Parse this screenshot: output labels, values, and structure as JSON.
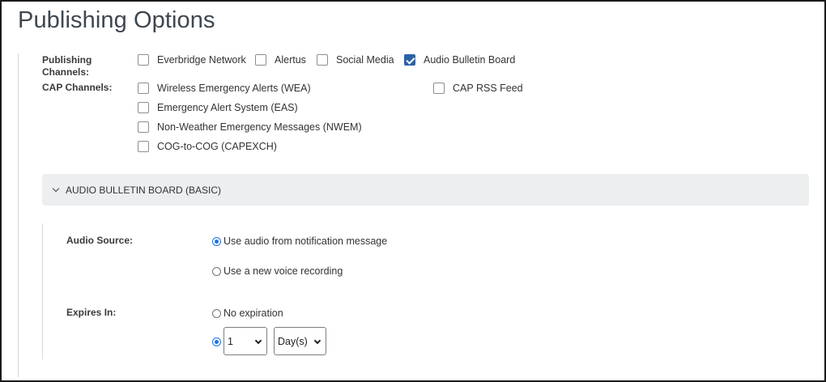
{
  "page_title": "Publishing Options",
  "publishing_channels": {
    "label": "Publishing Channels:",
    "options": [
      {
        "label": "Everbridge Network",
        "checked": false
      },
      {
        "label": "Alertus",
        "checked": false
      },
      {
        "label": "Social Media",
        "checked": false
      },
      {
        "label": "Audio Bulletin Board",
        "checked": true
      }
    ]
  },
  "cap_channels": {
    "label": "CAP Channels:",
    "options": [
      {
        "label": "Wireless Emergency Alerts (WEA)",
        "checked": false
      },
      {
        "label": "Emergency Alert System (EAS)",
        "checked": false
      },
      {
        "label": "Non-Weather Emergency Messages (NWEM)",
        "checked": false
      },
      {
        "label": "COG-to-COG (CAPEXCH)",
        "checked": false
      },
      {
        "label": "CAP RSS Feed",
        "checked": false
      }
    ]
  },
  "section": {
    "title": "AUDIO BULLETIN BOARD (BASIC)",
    "expanded": true
  },
  "audio_source": {
    "label": "Audio Source:",
    "options": [
      {
        "label": "Use audio from notification message",
        "selected": true
      },
      {
        "label": "Use a new voice recording",
        "selected": false
      }
    ]
  },
  "expires_in": {
    "label": "Expires In:",
    "options": [
      {
        "label": "No expiration",
        "selected": false
      },
      {
        "label": "",
        "selected": true
      }
    ],
    "amount": "1",
    "unit": "Day(s)"
  },
  "colors": {
    "checkbox_checked": "#2a62a8",
    "radio_selected": "#1a73e8",
    "section_header_bg": "#eceef0"
  }
}
